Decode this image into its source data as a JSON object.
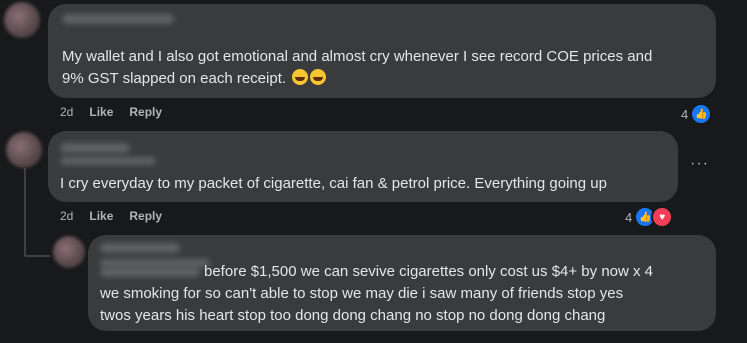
{
  "comments": [
    {
      "text_lines": [
        "My wallet and I also got emotional and almost cry whenever I see record COE prices and",
        "9% GST slapped on each receipt."
      ],
      "time": "2d",
      "like_label": "Like",
      "reply_label": "Reply",
      "reaction_count": "4",
      "reaction_icons": [
        "like-icon"
      ],
      "emojis": [
        "joy-emoji",
        "joy-emoji"
      ]
    },
    {
      "text_lines": [
        "I cry everyday to my packet of cigarette, cai fan & petrol price. Everything going up"
      ],
      "time": "2d",
      "like_label": "Like",
      "reply_label": "Reply",
      "reaction_count": "4",
      "reaction_icons": [
        "like-icon",
        "love-icon"
      ],
      "more_label": "···"
    },
    {
      "text_lines": [
        "before $1,500 we can sevive cigarettes only cost us $4+ by now x 4",
        "we smoking for so can't able to stop we may die i saw many of friends stop yes",
        "twos years his heart stop too dong dong chang no stop no dong dong chang"
      ]
    }
  ],
  "colors": {
    "background": "#18191a",
    "bubble": "#3a3b3c",
    "text": "#e4e6eb",
    "meta": "#b0b3b8",
    "like_blue": "#1877f2",
    "love_red": "#f33e58"
  }
}
